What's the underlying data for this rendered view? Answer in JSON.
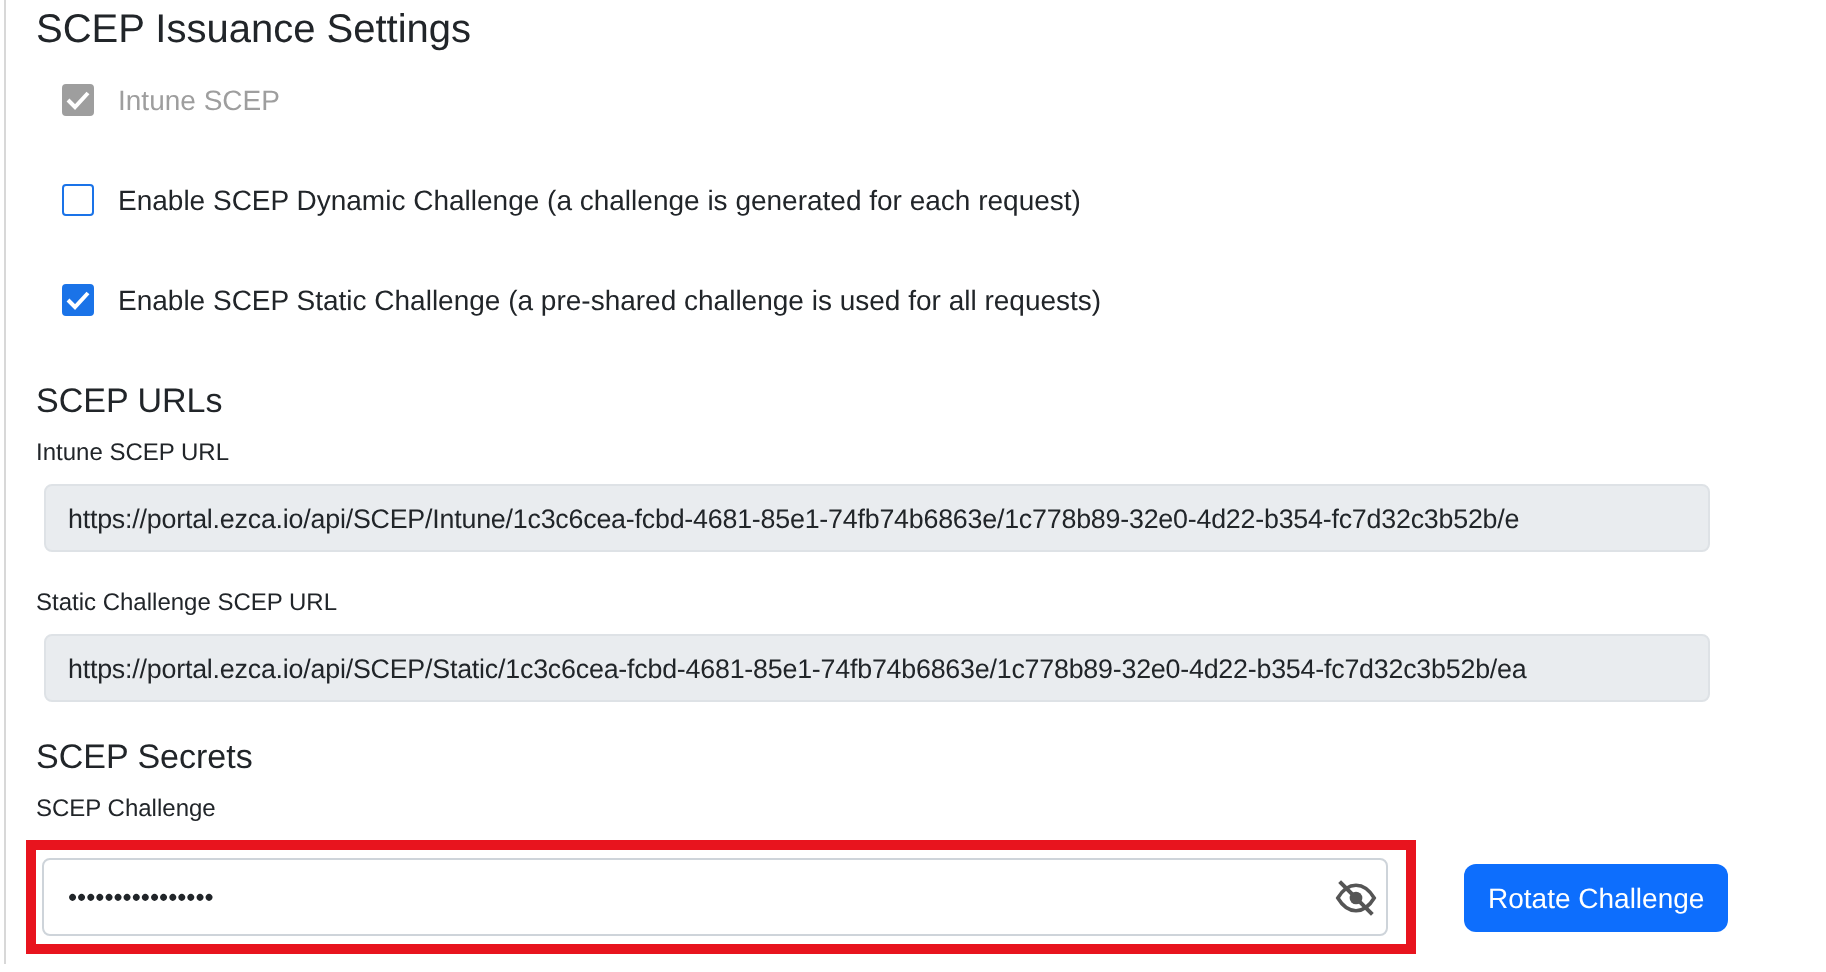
{
  "title": "SCEP Issuance Settings",
  "options": [
    {
      "label": "Intune SCEP",
      "checked": true,
      "disabled": true
    },
    {
      "label": "Enable SCEP Dynamic Challenge (a challenge is generated for each request)",
      "checked": false,
      "disabled": false
    },
    {
      "label": "Enable SCEP Static Challenge (a pre-shared challenge is used for all requests)",
      "checked": true,
      "disabled": false
    }
  ],
  "urls": {
    "heading": "SCEP URLs",
    "fields": [
      {
        "label": "Intune SCEP URL",
        "value": "https://portal.ezca.io/api/SCEP/Intune/1c3c6cea-fcbd-4681-85e1-74fb74b6863e/1c778b89-32e0-4d22-b354-fc7d32c3b52b/e"
      },
      {
        "label": "Static Challenge SCEP URL",
        "value": "https://portal.ezca.io/api/SCEP/Static/1c3c6cea-fcbd-4681-85e1-74fb74b6863e/1c778b89-32e0-4d22-b354-fc7d32c3b52b/ea"
      }
    ]
  },
  "secrets": {
    "heading": "SCEP Secrets",
    "label": "SCEP Challenge",
    "value": "••••••••••••••••",
    "highlighted": true,
    "button": "Rotate Challenge"
  }
}
